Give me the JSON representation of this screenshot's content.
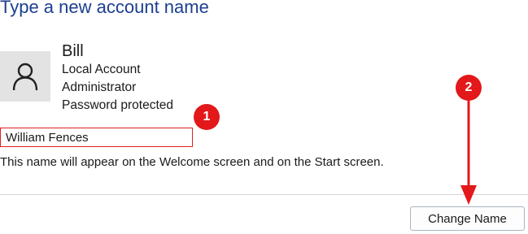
{
  "dialog": {
    "heading": "Type a new account name"
  },
  "account": {
    "name": "Bill",
    "details": [
      "Local Account",
      "Administrator",
      "Password protected"
    ]
  },
  "form": {
    "new_name_value": "William Fences",
    "note": "This name will appear on the Welcome screen and on the Start screen.",
    "submit_label": "Change Name"
  },
  "annotations": {
    "step1": "1",
    "step2": "2",
    "color": "#e3181a"
  },
  "icons": {
    "avatar": "person-icon"
  }
}
